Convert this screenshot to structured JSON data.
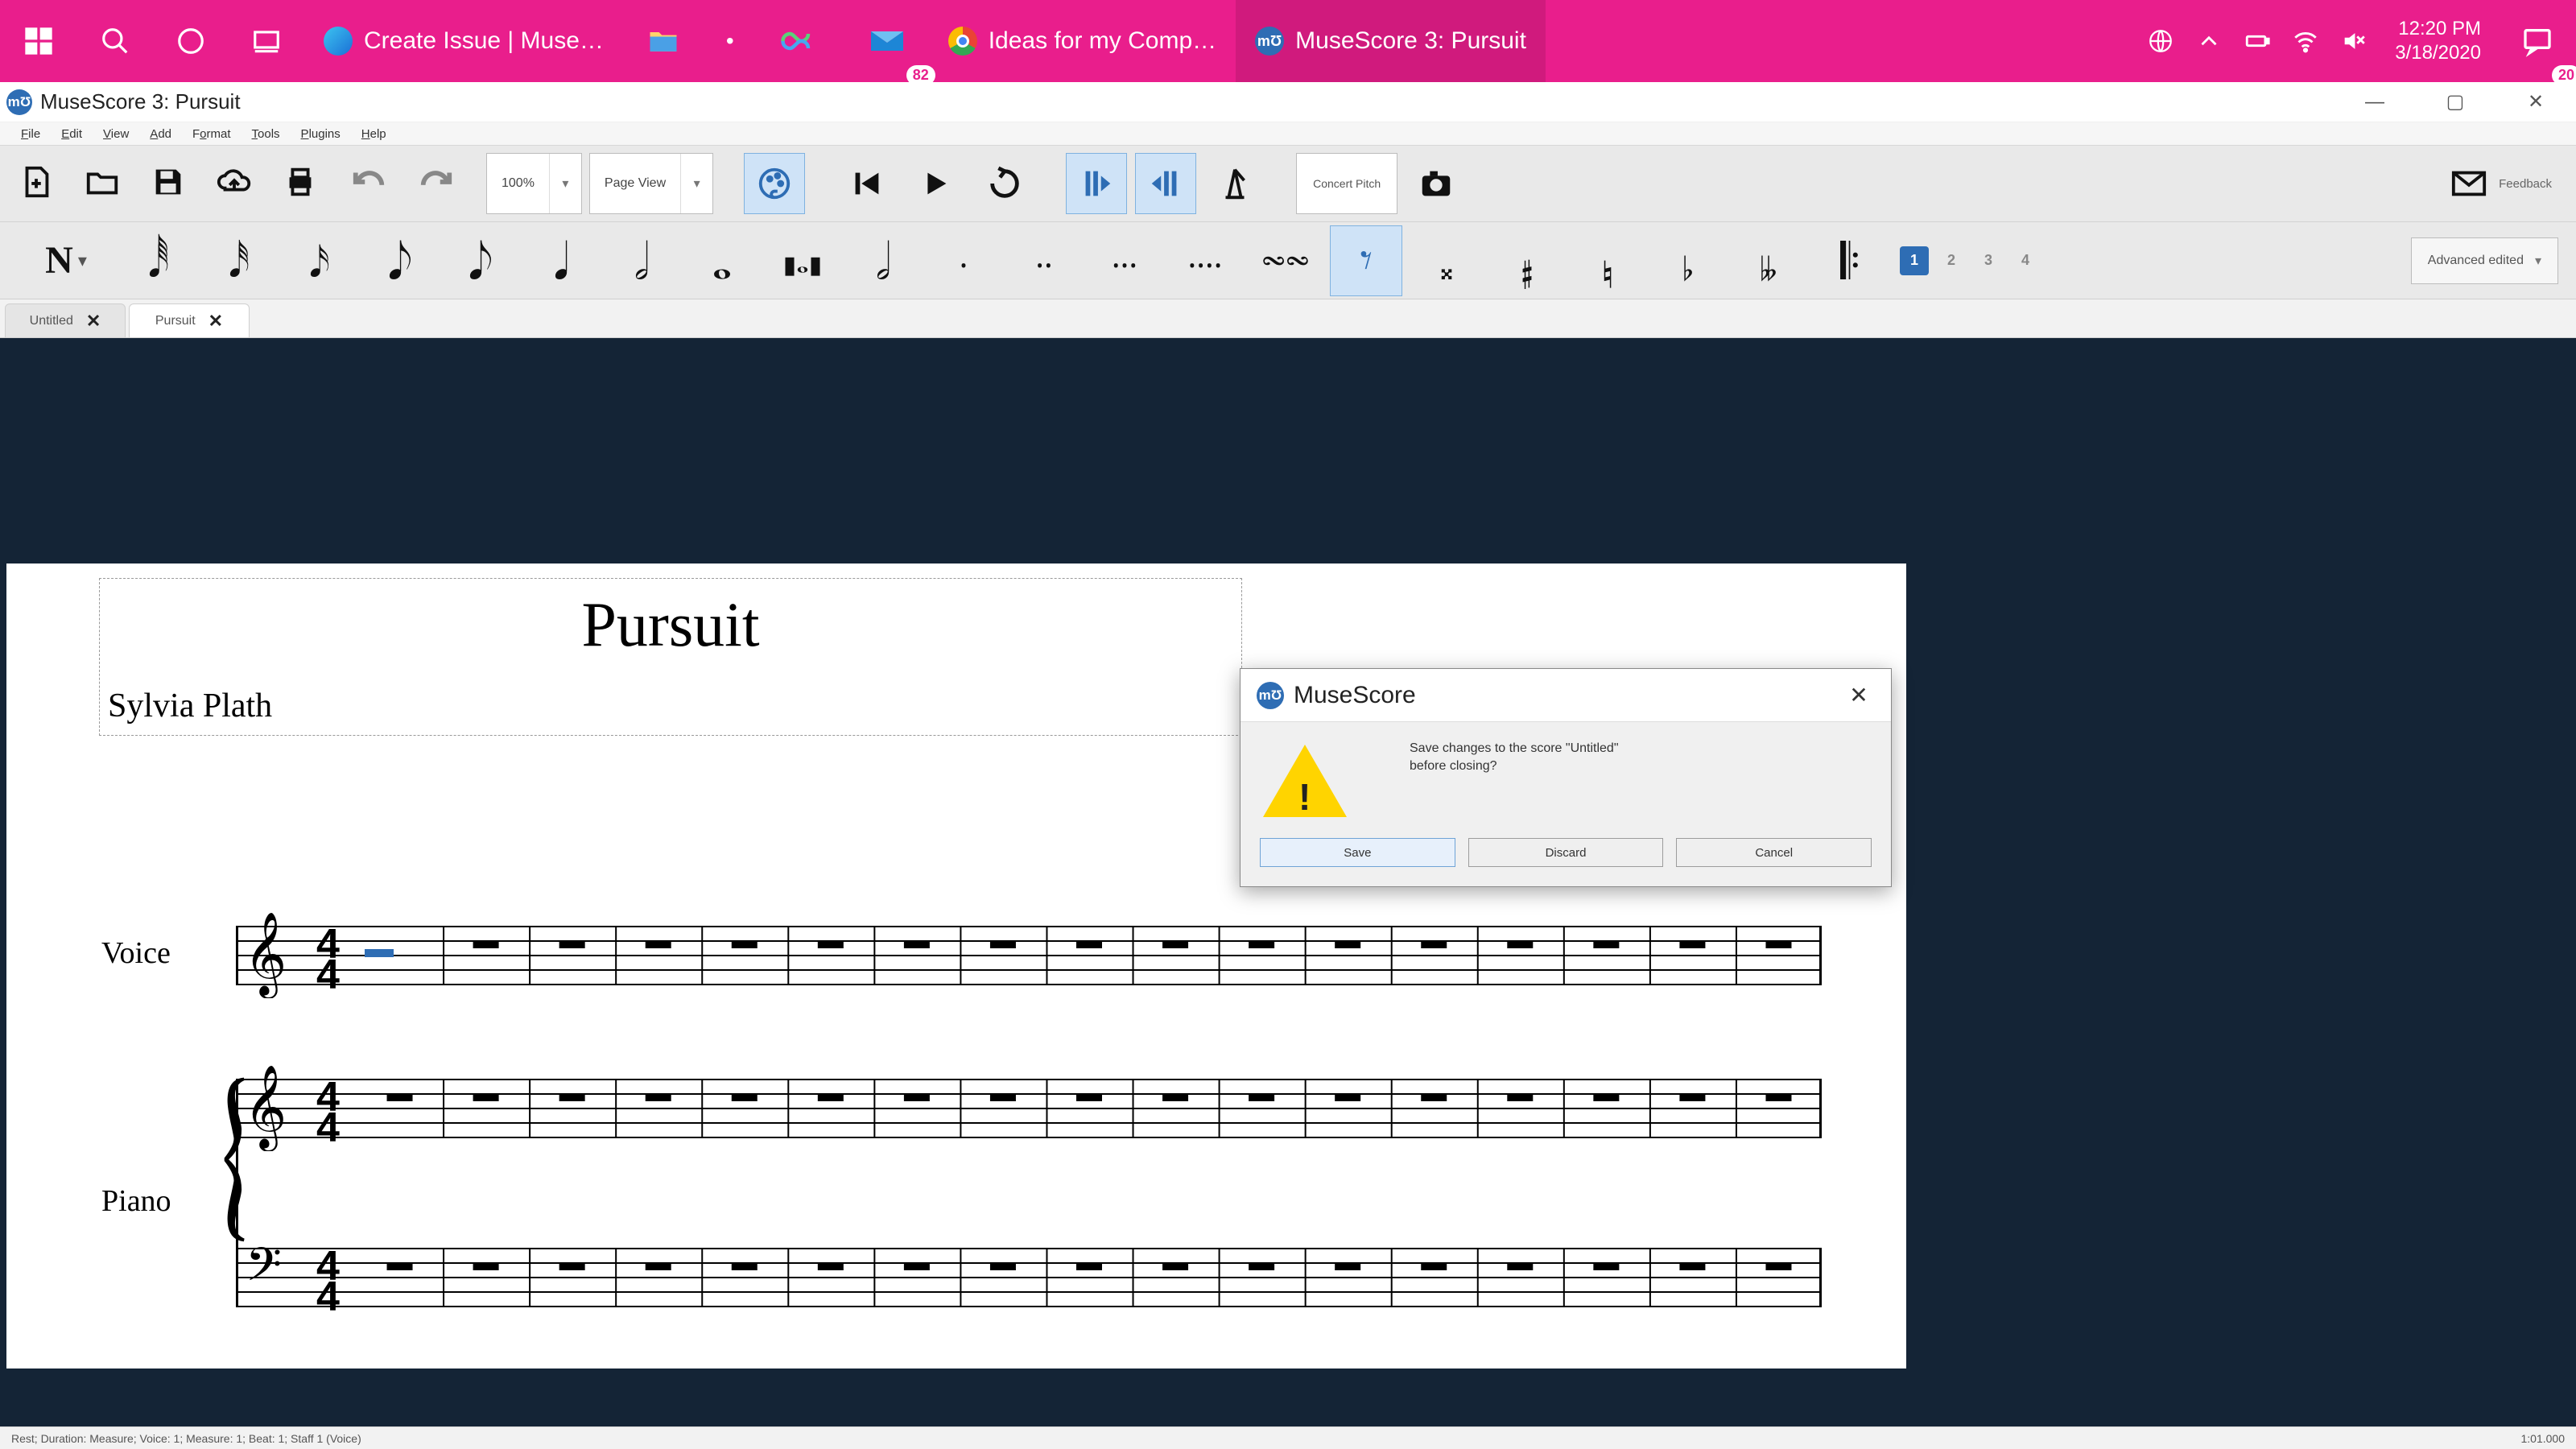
{
  "taskbar": {
    "items": [
      {
        "label": "Create Issue | Muse…"
      },
      {
        "label": "Ideas for my Comp…"
      },
      {
        "label": "MuseScore 3: Pursuit"
      }
    ],
    "mail_badge": "82",
    "action_badge": "20",
    "clock_time": "12:20 PM",
    "clock_date": "3/18/2020"
  },
  "window": {
    "title": "MuseScore 3: Pursuit"
  },
  "menu": [
    "File",
    "Edit",
    "View",
    "Add",
    "Format",
    "Tools",
    "Plugins",
    "Help"
  ],
  "toolbar1": {
    "zoom": "100%",
    "view_mode": "Page View",
    "concert_pitch": "Concert Pitch",
    "feedback": "Feedback"
  },
  "toolbar2": {
    "voices": [
      "1",
      "2",
      "3",
      "4"
    ],
    "advanced": "Advanced edited"
  },
  "tabs": [
    {
      "label": "Untitled",
      "active": false
    },
    {
      "label": "Pursuit",
      "active": true
    }
  ],
  "score": {
    "title": "Pursuit",
    "composer": "Sylvia Plath",
    "instruments": [
      "Voice",
      "Piano"
    ]
  },
  "dialog": {
    "app": "MuseScore",
    "message_l1": "Save changes to the score \"Untitled\"",
    "message_l2": "before closing?",
    "save": "Save",
    "discard": "Discard",
    "cancel": "Cancel"
  },
  "status": {
    "left": "Rest; Duration: Measure; Voice: 1; Measure: 1; Beat: 1; Staff 1 (Voice)",
    "right": "1:01.000"
  }
}
